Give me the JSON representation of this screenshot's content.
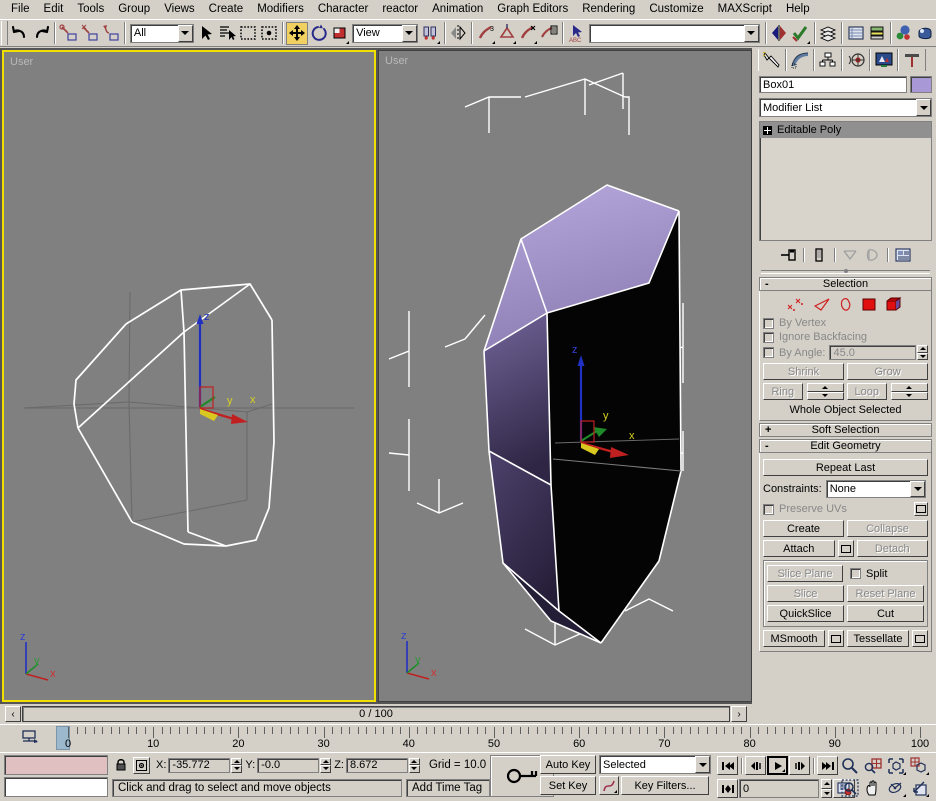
{
  "menu": {
    "items": [
      "File",
      "Edit",
      "Tools",
      "Group",
      "Views",
      "Create",
      "Modifiers",
      "Character",
      "reactor",
      "Animation",
      "Graph Editors",
      "Rendering",
      "Customize",
      "MAXScript",
      "Help"
    ]
  },
  "toolbar": {
    "selection_filter": "All",
    "reference_coord": "View",
    "named_selection": "",
    "icons": [
      "undo-icon",
      "redo-icon",
      "select-link-icon",
      "unlink-icon",
      "bind-spacewarp-icon",
      "select-object-icon",
      "select-by-name-icon",
      "rectangular-select-icon",
      "select-region-icon",
      "select-move-icon",
      "select-rotate-icon",
      "select-scale-icon",
      "use-pivot-icon",
      "mirror-icon",
      "align-icon",
      "layer-manager-icon",
      "curve-editor-icon",
      "schematic-view-icon",
      "material-editor-icon",
      "render-scene-icon",
      "quick-render-icon"
    ]
  },
  "viewports": {
    "left": {
      "label": "User",
      "active": true,
      "axis_labels": {
        "z": "z",
        "y": "y",
        "x": "x"
      }
    },
    "right": {
      "label": "User",
      "active": false,
      "axis_labels": {
        "z": "z",
        "y": "y",
        "x": "x"
      }
    },
    "gizmo_labels": {
      "z": "z",
      "y": "y",
      "x": "x"
    },
    "object_color": "#a899d6"
  },
  "command_panel": {
    "tabs": [
      "create-tab-icon",
      "modify-tab-icon",
      "hierarchy-tab-icon",
      "motion-tab-icon",
      "display-tab-icon",
      "utilities-tab-icon"
    ],
    "object_name": "Box01",
    "object_color": "#a899d6",
    "modifier_list_label": "Modifier List",
    "stack": [
      {
        "label": "Editable Poly",
        "selected": true
      }
    ],
    "stack_buttons": [
      "pin-stack-icon",
      "show-end-result-icon",
      "make-unique-icon",
      "remove-modifier-icon",
      "configure-sets-icon"
    ],
    "selection": {
      "title": "Selection",
      "sign": "-",
      "sub_object_icons": [
        "vertex-icon",
        "edge-icon",
        "border-icon",
        "polygon-icon",
        "element-icon"
      ],
      "by_vertex": "By Vertex",
      "ignore_backfacing": "Ignore Backfacing",
      "by_angle": "By Angle:",
      "by_angle_value": "45.0",
      "shrink": "Shrink",
      "grow": "Grow",
      "ring": "Ring",
      "loop": "Loop",
      "status": "Whole Object Selected"
    },
    "soft_selection": {
      "title": "Soft Selection",
      "sign": "+"
    },
    "edit_geometry": {
      "title": "Edit Geometry",
      "sign": "-",
      "repeat_last": "Repeat Last",
      "constraints_label": "Constraints:",
      "constraints_value": "None",
      "preserve_uvs": "Preserve UVs",
      "create": "Create",
      "collapse": "Collapse",
      "attach": "Attach",
      "detach": "Detach",
      "slice_plane": "Slice Plane",
      "split": "Split",
      "slice": "Slice",
      "reset_plane": "Reset Plane",
      "quickslice": "QuickSlice",
      "cut": "Cut",
      "msmooth": "MSmooth",
      "tessellate": "Tessellate"
    }
  },
  "timeline": {
    "current_frame_label": "0 / 100",
    "prev_arrow": "‹",
    "next_arrow": "›",
    "range_start": 0,
    "range_end": 100,
    "tick_labels": [
      0,
      10,
      20,
      30,
      40,
      50,
      60,
      70,
      80,
      90,
      100
    ],
    "slider_position": 0
  },
  "status": {
    "x_label": "X:",
    "x_value": "-35.772",
    "y_label": "Y:",
    "y_value": "-0.0",
    "z_label": "Z:",
    "z_value": "8.672",
    "grid": "Grid = 10.0",
    "prompt": "Click and drag to select and move objects",
    "add_time_tag": "Add Time Tag",
    "lock_icon": "lock-selection-icon",
    "coord_icon": "absolute-mode-icon"
  },
  "animation": {
    "auto_key": "Auto Key",
    "set_key": "Set Key",
    "key_mode_value": "Selected",
    "key_filters": "Key Filters...",
    "curve_icon": "key-curve-icon",
    "key_icon": "set-key-icon",
    "frame_field": "0",
    "playback_icons": [
      "goto-start-icon",
      "prev-frame-icon",
      "play-icon",
      "next-frame-icon",
      "goto-end-icon",
      "key-mode-toggle-icon",
      "time-config-icon"
    ]
  },
  "navigation": {
    "icons": [
      "zoom-icon",
      "zoom-all-icon",
      "zoom-extents-icon",
      "zoom-extents-all-icon",
      "zoom-region-icon",
      "pan-icon",
      "arc-rotate-icon",
      "maximize-viewport-icon"
    ]
  },
  "chart_data": null
}
